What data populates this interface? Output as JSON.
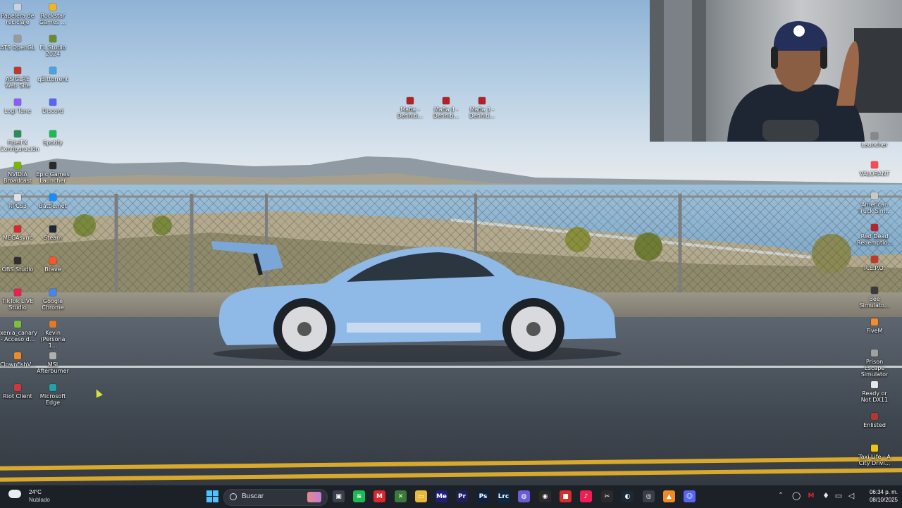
{
  "desktop": {
    "left_icons": [
      {
        "label": "Papelera de reciclaje",
        "icon": "recycle-bin-icon",
        "color": "#c9d3dd"
      },
      {
        "label": "Rockstar Games ...",
        "icon": "rockstar-icon",
        "color": "#f2b51c"
      },
      {
        "label": "ATS OpenGL",
        "icon": "truck-icon",
        "color": "#9a9a9a"
      },
      {
        "label": "FL Studio 2024",
        "icon": "fl-studio-icon",
        "color": "#6f8a2a"
      },
      {
        "label": "ASIGLRE Web Site",
        "icon": "globe-icon",
        "color": "#c2372b"
      },
      {
        "label": "qBittorrent",
        "icon": "qbittorrent-icon",
        "color": "#4aa3df"
      },
      {
        "label": "Logi Tune",
        "icon": "logi-tune-icon",
        "color": "#8b5cf6"
      },
      {
        "label": "Discord",
        "icon": "discord-icon",
        "color": "#5865f2"
      },
      {
        "label": "FidelFX Configuración",
        "icon": "fidelfx-icon",
        "color": "#2e8b57"
      },
      {
        "label": "Spotify",
        "icon": "spotify-icon",
        "color": "#1db954"
      },
      {
        "label": "NVIDIA Broadcast",
        "icon": "nvidia-icon",
        "color": "#76b900"
      },
      {
        "label": "Epic Games Launcher",
        "icon": "epic-games-icon",
        "color": "#2a2a2a"
      },
      {
        "label": "RPCS3",
        "icon": "rpcs3-icon",
        "color": "#e0e0e0"
      },
      {
        "label": "Battle.net",
        "icon": "battlenet-icon",
        "color": "#148eff"
      },
      {
        "label": "MEGAsync",
        "icon": "mega-icon",
        "color": "#d9272e"
      },
      {
        "label": "Steam",
        "icon": "steam-icon",
        "color": "#1b2838"
      },
      {
        "label": "OBS Studio",
        "icon": "obs-icon",
        "color": "#302e31"
      },
      {
        "label": "Brave",
        "icon": "brave-icon",
        "color": "#fb542b"
      },
      {
        "label": "TikTok LIVE Studio",
        "icon": "tiktok-icon",
        "color": "#ee1d52"
      },
      {
        "label": "Google Chrome",
        "icon": "chrome-icon",
        "color": "#4285f4"
      },
      {
        "label": "xenia_canary - Acceso d...",
        "icon": "xenia-icon",
        "color": "#7bbf3a"
      },
      {
        "label": "Kevin (Persona 1...",
        "icon": "user-profile-icon",
        "color": "#e07a2a"
      },
      {
        "label": "ClownfishV...",
        "icon": "clownfish-icon",
        "color": "#f08a24"
      },
      {
        "label": "MSI Afterburner",
        "icon": "msi-afterburner-icon",
        "color": "#b0b0b0"
      },
      {
        "label": "Riot Client",
        "icon": "riot-icon",
        "color": "#d13639"
      },
      {
        "label": "Microsoft Edge",
        "icon": "edge-icon",
        "color": "#1fa3a6"
      }
    ],
    "center_icons": [
      {
        "label": "Mafia - Definiti...",
        "icon": "mafia-icon",
        "color": "#b22222"
      },
      {
        "label": "Mafia II - Definiti...",
        "icon": "mafia-ii-icon",
        "color": "#b22222"
      },
      {
        "label": "Mafia 3 - Definiti...",
        "icon": "mafia-iii-icon",
        "color": "#b22222"
      }
    ],
    "right_icons": [
      {
        "label": "Launcher",
        "icon": "launcher-icon",
        "color": "#888888"
      },
      {
        "label": "VALORANT",
        "icon": "valorant-icon",
        "color": "#ff4655"
      },
      {
        "label": "American Truck Sim...",
        "icon": "ats-icon",
        "color": "#c8c8c8"
      },
      {
        "label": "Red Dead Redemptio...",
        "icon": "rdr-icon",
        "color": "#b3262b"
      },
      {
        "label": "R.E.P.O.",
        "icon": "repo-icon",
        "color": "#c0392b"
      },
      {
        "label": "Bee Simulato...",
        "icon": "bee-icon",
        "color": "#3a3a3a"
      },
      {
        "label": "FiveM",
        "icon": "fivem-icon",
        "color": "#f58b2a"
      },
      {
        "label": "Prison Escape Simulator",
        "icon": "prison-escape-icon",
        "color": "#a0a0a0"
      },
      {
        "label": "Ready or Not DX11",
        "icon": "ready-or-not-icon",
        "color": "#e6e6e6"
      },
      {
        "label": "Enlisted",
        "icon": "enlisted-icon",
        "color": "#b03a2e"
      },
      {
        "label": "Taxi Life - A City Drivi...",
        "icon": "taxi-life-icon",
        "color": "#f1c40f"
      }
    ]
  },
  "taskbar": {
    "weather": {
      "temp": "24°C",
      "condition": "Nublado"
    },
    "search_label": "Buscar",
    "apps": [
      {
        "name": "task-view-icon",
        "glyph": "▣",
        "color": "#3b4048"
      },
      {
        "name": "spotify-icon",
        "glyph": "≋",
        "color": "#1db954"
      },
      {
        "name": "mega-icon",
        "glyph": "M",
        "color": "#d9272e"
      },
      {
        "name": "xbox-icon",
        "glyph": "✕",
        "color": "#3a7a3a"
      },
      {
        "name": "file-explorer-icon",
        "glyph": "▭",
        "color": "#e8b83a"
      },
      {
        "name": "media-encoder-icon",
        "glyph": "Me",
        "color": "#1f1f7a"
      },
      {
        "name": "premiere-icon",
        "glyph": "Pr",
        "color": "#1f1f5a"
      },
      {
        "name": "photoshop-icon",
        "glyph": "Ps",
        "color": "#0a2342"
      },
      {
        "name": "lightroom-classic-icon",
        "glyph": "Lrc",
        "color": "#0b2a44"
      },
      {
        "name": "controller-icon",
        "glyph": "◍",
        "color": "#6b5bd6"
      },
      {
        "name": "obs-icon",
        "glyph": "◉",
        "color": "#2a2a2a"
      },
      {
        "name": "red-app-icon",
        "glyph": "■",
        "color": "#d62d2d"
      },
      {
        "name": "tiktok-icon",
        "glyph": "♪",
        "color": "#ee1d52"
      },
      {
        "name": "capcut-icon",
        "glyph": "✂",
        "color": "#2a2a2a"
      },
      {
        "name": "steam-icon",
        "glyph": "◐",
        "color": "#1b2838"
      },
      {
        "name": "vpn-icon",
        "glyph": "◎",
        "color": "#3a3f47"
      },
      {
        "name": "vlc-icon",
        "glyph": "▲",
        "color": "#f08a24"
      },
      {
        "name": "discord-icon",
        "glyph": "☺",
        "color": "#5865f2"
      }
    ],
    "clock": {
      "time": "06:34 p. m.",
      "date": "08/10/2025"
    }
  }
}
